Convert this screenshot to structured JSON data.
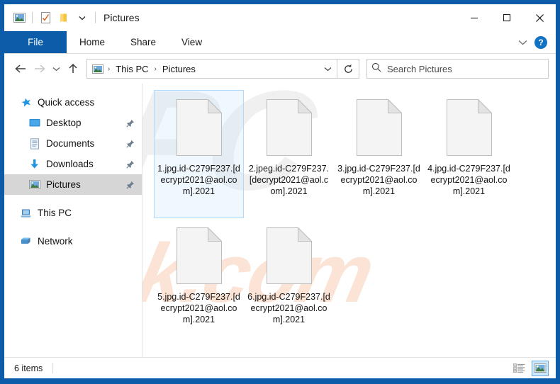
{
  "window": {
    "title": "Pictures",
    "quick_access_icons": [
      "picture-icon",
      "properties-icon",
      "new-folder-icon",
      "customize-chevron-icon"
    ],
    "controls": {
      "minimize": "minimize-icon",
      "maximize": "maximize-icon",
      "close": "close-icon"
    }
  },
  "ribbon": {
    "tabs": [
      {
        "label": "File",
        "active": true
      },
      {
        "label": "Home",
        "active": false
      },
      {
        "label": "Share",
        "active": false
      },
      {
        "label": "View",
        "active": false
      }
    ],
    "expand_icon": "chevron-down-icon",
    "help_label": "?"
  },
  "address": {
    "back_icon": "arrow-left-icon",
    "forward_icon": "arrow-right-icon",
    "recent_icon": "chevron-down-icon",
    "up_icon": "arrow-up-icon",
    "location_icon": "picture-icon",
    "crumbs": [
      "This PC",
      "Pictures"
    ],
    "crumb_separator": "›",
    "dropdown_icon": "chevron-down-icon",
    "refresh_icon": "refresh-icon"
  },
  "search": {
    "icon": "search-icon",
    "placeholder": "Search Pictures",
    "value": ""
  },
  "sidebar": {
    "items": [
      {
        "label": "Quick access",
        "icon": "star-icon",
        "child": false,
        "pinned": false,
        "selected": false
      },
      {
        "label": "Desktop",
        "icon": "desktop-icon",
        "child": true,
        "pinned": true,
        "selected": false
      },
      {
        "label": "Documents",
        "icon": "documents-icon",
        "child": true,
        "pinned": true,
        "selected": false
      },
      {
        "label": "Downloads",
        "icon": "downloads-icon",
        "child": true,
        "pinned": true,
        "selected": false
      },
      {
        "label": "Pictures",
        "icon": "picture-icon",
        "child": true,
        "pinned": true,
        "selected": true
      },
      {
        "label": "This PC",
        "icon": "this-pc-icon",
        "child": false,
        "pinned": false,
        "selected": false
      },
      {
        "label": "Network",
        "icon": "network-icon",
        "child": false,
        "pinned": false,
        "selected": false
      }
    ]
  },
  "files": [
    {
      "name": "1.jpg.id-C279F237.[decrypt2021@aol.com].2021",
      "icon": "generic-file-icon",
      "selected": true
    },
    {
      "name": "2.jpeg.id-C279F237.[decrypt2021@aol.com].2021",
      "icon": "generic-file-icon",
      "selected": false
    },
    {
      "name": "3.jpg.id-C279F237.[decrypt2021@aol.com].2021",
      "icon": "generic-file-icon",
      "selected": false
    },
    {
      "name": "4.jpg.id-C279F237.[decrypt2021@aol.com].2021",
      "icon": "generic-file-icon",
      "selected": false
    },
    {
      "name": "5.jpg.id-C279F237.[decrypt2021@aol.com].2021",
      "icon": "generic-file-icon",
      "selected": false
    },
    {
      "name": "6.jpg.id-C279F237.[decrypt2021@aol.com].2021",
      "icon": "generic-file-icon",
      "selected": false
    }
  ],
  "status": {
    "item_count": "6 items",
    "view_buttons": [
      {
        "icon": "details-view-icon",
        "active": false
      },
      {
        "icon": "large-icons-view-icon",
        "active": true
      }
    ]
  },
  "watermark": {
    "grey_text": "PC",
    "orange_text": "risk.com",
    "grey_color": "#f0f0f0",
    "orange_color": "#fbe4d6"
  },
  "colors": {
    "frame": "#0c5ca9",
    "accent": "#0c5ca9",
    "selection": "#cde8ff",
    "selection_border": "#addaff",
    "sidebar_selected": "#d6d6d6"
  }
}
